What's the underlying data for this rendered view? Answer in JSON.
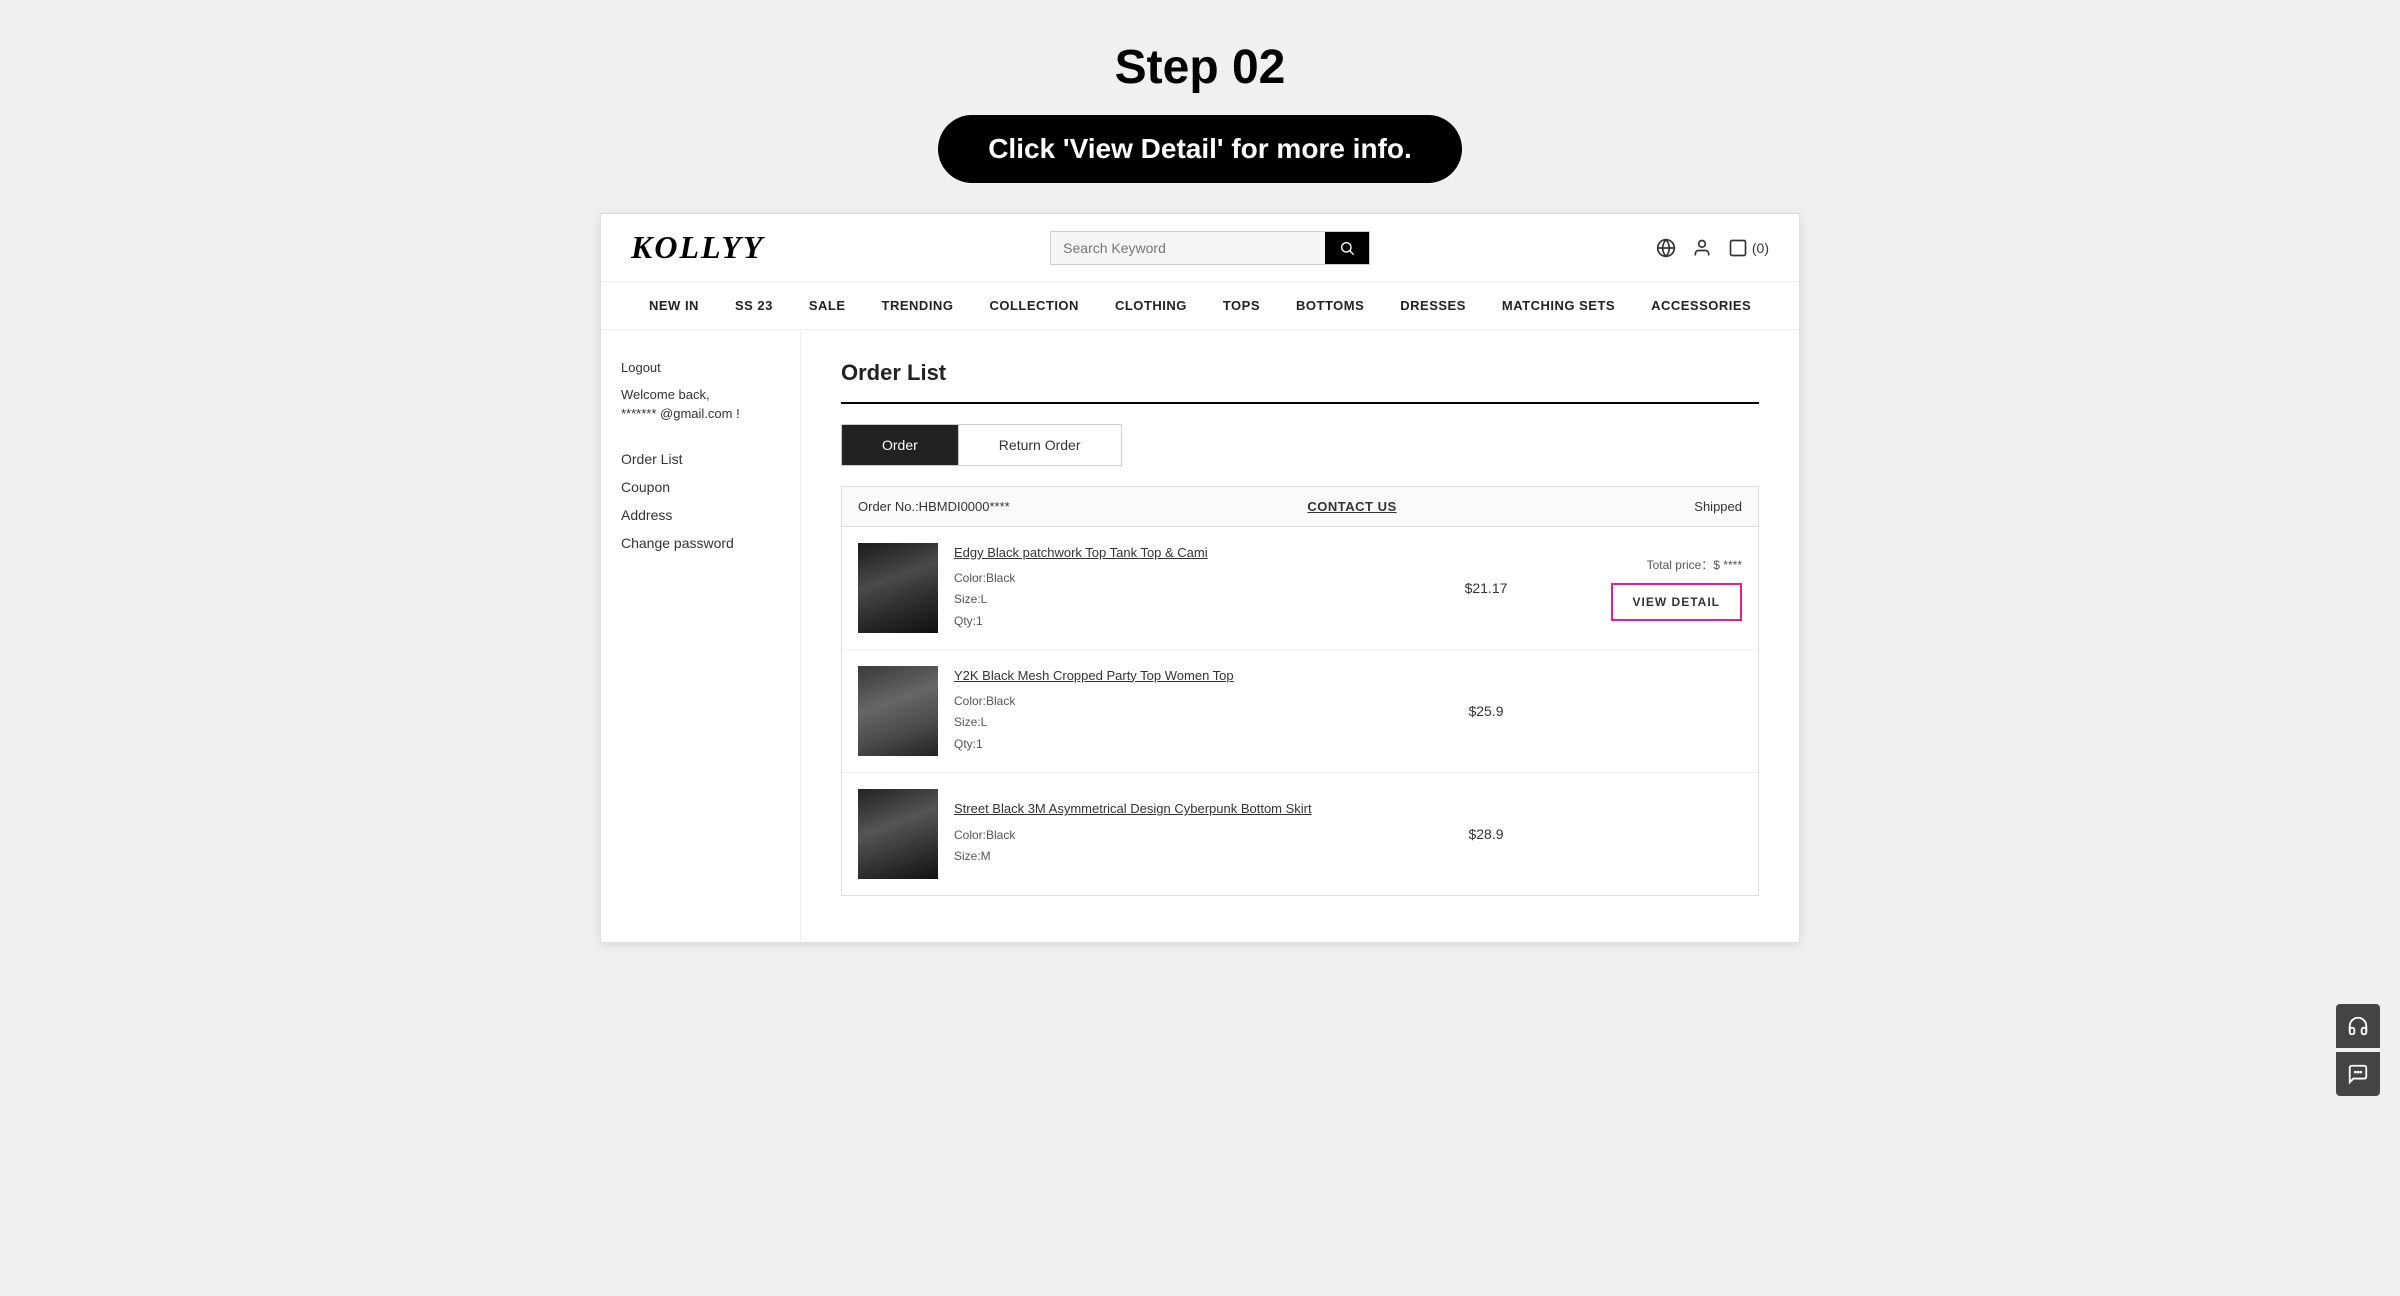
{
  "instruction": {
    "step": "Step 02",
    "pill_text": "Click 'View Detail' for more info."
  },
  "header": {
    "logo": "KOLLYY",
    "search_placeholder": "Search Keyword",
    "search_label": "Search",
    "globe_icon": "🌐",
    "user_icon": "👤",
    "cart_text": "⬜(0)"
  },
  "nav": {
    "items": [
      {
        "label": "NEW IN"
      },
      {
        "label": "SS 23"
      },
      {
        "label": "SALE"
      },
      {
        "label": "TRENDING"
      },
      {
        "label": "COLLECTION"
      },
      {
        "label": "CLOTHING"
      },
      {
        "label": "TOPS"
      },
      {
        "label": "BOTTOMS"
      },
      {
        "label": "DRESSES"
      },
      {
        "label": "MATCHING SETS"
      },
      {
        "label": "ACCESSORIES"
      }
    ]
  },
  "sidebar": {
    "logout_label": "Logout",
    "welcome_text": "Welcome back,",
    "email": "******* @gmail.com !",
    "nav_items": [
      {
        "label": "Order List"
      },
      {
        "label": "Coupon"
      },
      {
        "label": "Address"
      },
      {
        "label": "Change password"
      }
    ]
  },
  "main": {
    "page_title": "Order List",
    "tabs": [
      {
        "label": "Order",
        "active": true
      },
      {
        "label": "Return Order",
        "active": false
      }
    ],
    "orders": [
      {
        "order_number": "Order No.:HBMDI0000****",
        "contact_us": "CONTACT US",
        "status": "Shipped",
        "items": [
          {
            "name": "Edgy Black patchwork Top Tank Top & Cami",
            "color": "Color:Black",
            "size": "Size:L",
            "qty": "Qty:1",
            "price": "$21.17",
            "total_label": "Total price：$ ****",
            "view_detail_label": "VIEW DETAIL",
            "image_style": "dark"
          },
          {
            "name": "Y2K Black Mesh Cropped Party Top Women Top",
            "color": "Color:Black",
            "size": "Size:L",
            "qty": "Qty:1",
            "price": "$25.9",
            "total_label": "",
            "view_detail_label": "",
            "image_style": "med"
          },
          {
            "name": "Street Black 3M Asymmetrical Design Cyberpunk Bottom Skirt",
            "color": "Color:Black",
            "size": "Size:M",
            "qty": "",
            "price": "$28.9",
            "total_label": "",
            "view_detail_label": "",
            "image_style": "dark"
          }
        ]
      }
    ]
  },
  "floating": {
    "headset_icon": "🎧",
    "chat_icon": "💬"
  }
}
